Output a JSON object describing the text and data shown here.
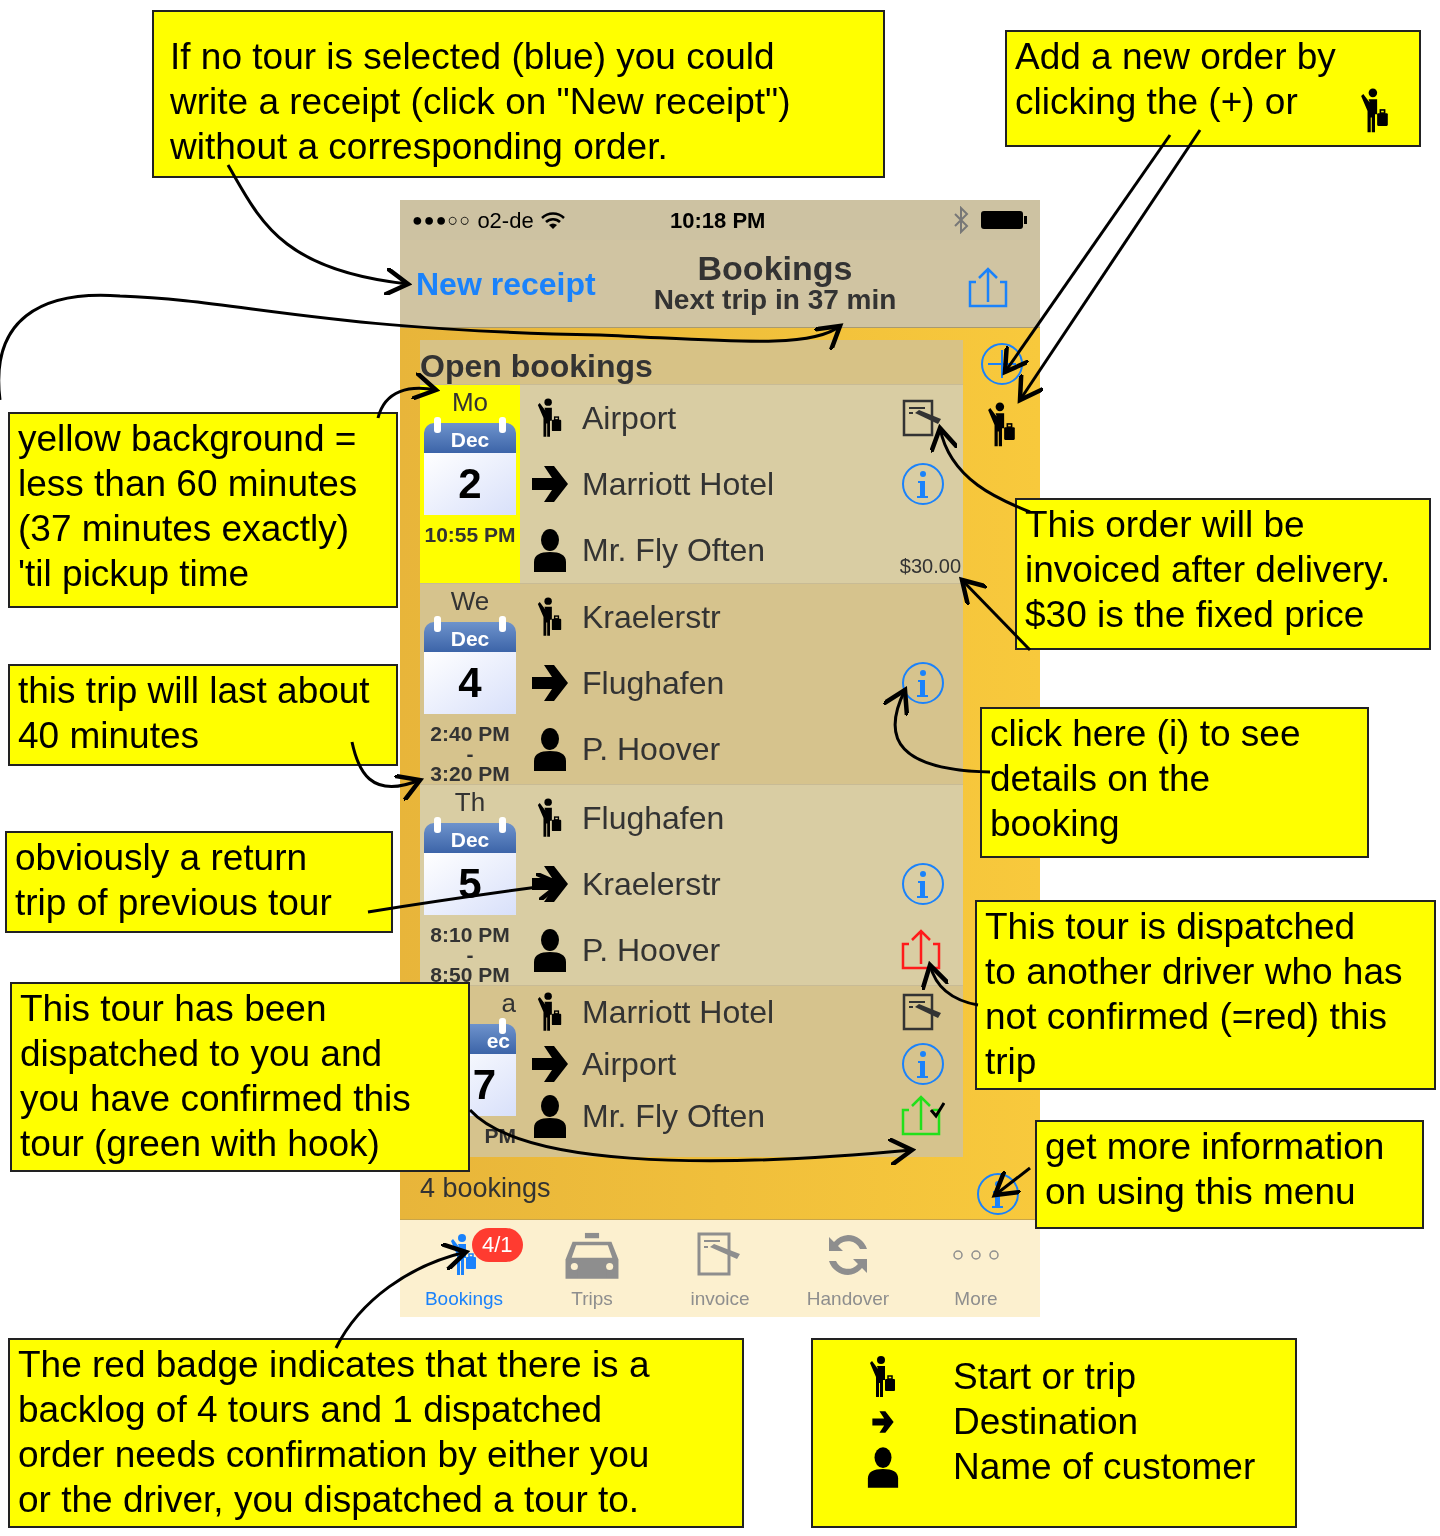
{
  "status_bar": {
    "signal": "●●●○○",
    "carrier": "o2-de",
    "time": "10:18 PM"
  },
  "nav_bar": {
    "left_button": "New receipt",
    "title": "Bookings",
    "subtitle": "Next trip in 37 min"
  },
  "section_header": "Open bookings",
  "bookings": [
    {
      "weekday": "Mo",
      "month": "Dec",
      "day": "2",
      "time_from": "10:55 PM",
      "highlighted": true,
      "covered": false,
      "pickup": "Airport",
      "destination": "Marriott Hotel",
      "customer": "Mr. Fly Often",
      "price": "$30.00",
      "invoice": true,
      "dispatched": false
    },
    {
      "weekday": "We",
      "month": "Dec",
      "day": "4",
      "time_from": "2:40 PM",
      "time_separator": "-",
      "time_to": "3:20 PM",
      "highlighted": false,
      "covered": false,
      "pickup": "Kraelerstr",
      "destination": "Flughafen",
      "customer": "P. Hoover",
      "invoice": false,
      "dispatched": false
    },
    {
      "weekday": "Th",
      "month": "Dec",
      "day": "5",
      "time_from": "8:10 PM",
      "time_separator": "-",
      "time_to": "8:50 PM",
      "highlighted": false,
      "covered": false,
      "pickup": "Flughafen",
      "destination": "Kraelerstr",
      "customer": "P. Hoover",
      "invoice": false,
      "dispatched": true,
      "confirmed": false
    },
    {
      "weekday": "a",
      "month": "ec",
      "day": "7",
      "time_from": "PM",
      "highlighted": false,
      "covered": true,
      "pickup": "Marriott Hotel",
      "destination": "Airport",
      "customer": "Mr. Fly Often",
      "invoice": true,
      "dispatched": true,
      "confirmed": true
    }
  ],
  "footer": "4 bookings",
  "tabs": [
    {
      "label": "Bookings",
      "kind": "bookings",
      "selected": true,
      "badge": "4/1"
    },
    {
      "label": "Trips",
      "kind": "trips",
      "selected": false
    },
    {
      "label": "invoice",
      "kind": "invoice",
      "selected": false
    },
    {
      "label": "Handover",
      "kind": "handover",
      "selected": false
    },
    {
      "label": "More",
      "kind": "more",
      "selected": false
    }
  ],
  "callouts": [
    {
      "text": "If no tour is selected (blue) you could\nwrite a receipt (click on \"New receipt\")\nwithout a corresponding order."
    },
    {
      "text": "Add a new order by\nclicking the (+) or",
      "icon": true
    },
    {
      "text": "yellow background =\nless than 60 minutes\n(37 minutes exactly)\n'til pickup time"
    },
    {
      "text": "this trip will last about\n40 minutes"
    },
    {
      "text": "obviously a return\ntrip of previous tour"
    },
    {
      "text": "This tour has been\ndispatched to you and\nyou have confirmed this\ntour (green with hook)"
    },
    {
      "text": "This order will be\ninvoiced after delivery.\n$30 is the fixed price"
    },
    {
      "text": "click here (i) to see\ndetails on the\nbooking"
    },
    {
      "text": "This tour is dispatched\nto another driver who has\nnot confirmed (=red) this\ntrip"
    },
    {
      "text": "get more information\non using this menu"
    },
    {
      "text": "The red badge indicates that there is a\nbacklog of 4 tours and 1 dispatched\norder needs confirmation by either you\nor the driver, you dispatched a tour to."
    }
  ],
  "legend": [
    {
      "kind": "pickup",
      "text": "Start or trip"
    },
    {
      "kind": "destination",
      "text": "Destination"
    },
    {
      "kind": "customer",
      "text": "Name of customer"
    }
  ]
}
